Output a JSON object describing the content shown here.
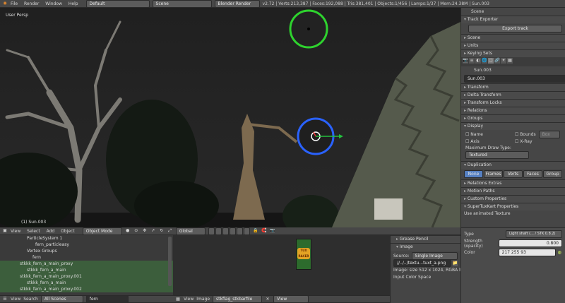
{
  "topbar": {
    "menus": [
      "File",
      "Render",
      "Window",
      "Help"
    ],
    "layout": "Default",
    "scene": "Scene",
    "engine": "Blender Render",
    "stats": "v2.72 | Verts:213,387 | Faces:192,088 | Tris:381,401 | Objects:1/456 | Lamps:1/37 | Mem:24.38M | Sun.003"
  },
  "viewport": {
    "label_view": "User Persp",
    "label_object": "(1) Sun.003",
    "header": {
      "menus": [
        "View",
        "Select",
        "Add",
        "Object"
      ],
      "mode": "Object Mode",
      "pivot": "Global"
    }
  },
  "outliner": {
    "rows": [
      "ParticleSystem 1",
      "fern_particleasy",
      "Vertex Groups",
      "fern",
      "stkkk_fern_a_main_proxy",
      "stkkk_fern_a_main",
      "stkkk_fern_a_main_proxy.001",
      "stkkk_fern_a_main",
      "stkkk_fern_a_main_proxy.002",
      "stkkk_fern_a_main"
    ],
    "footer": {
      "view": "View",
      "search": "Search",
      "filter": "All Scenes",
      "query": "fern"
    }
  },
  "image_editor": {
    "footer": {
      "view": "View",
      "image": "Image",
      "name": "stkflag_stkbarfile",
      "view2": "View"
    },
    "thumb_text": "TUX RACER"
  },
  "image_props": {
    "grease": "Grease Pencil",
    "image_title": "Image",
    "source_label": "Source:",
    "source_value": "Single Image",
    "path": "//../../textu...tuxt_a.png",
    "info": "Image: size 512 x 1024, RGBA byte",
    "colorspace": "Input Color Space"
  },
  "properties": {
    "scene_name": "Scene",
    "track_exporter": "Track Exporter",
    "export_button": "Export track",
    "panels_a": [
      "Scene",
      "Units",
      "Keying Sets"
    ],
    "object_name": "Sun.003",
    "object_field": "Sun.003",
    "panels_b": [
      "Transform",
      "Delta Transform",
      "Transform Locks",
      "Relations",
      "Groups"
    ],
    "display_title": "Display",
    "display_checks": {
      "name": "Name",
      "axis": "Axis",
      "bounds": "Bounds",
      "box": "Box",
      "xray": "X-Ray"
    },
    "max_draw_label": "Maximum Draw Type:",
    "max_draw_value": "Textured",
    "duplication_title": "Duplication",
    "dup_tabs": [
      "None",
      "Frames",
      "Verts",
      "Faces",
      "Group"
    ],
    "panels_c": [
      "Relations Extras",
      "Motion Paths",
      "Custom Properties",
      "SuperTuxKart Properties"
    ],
    "animated_texture": "Use animated Texture"
  },
  "stk_props": {
    "type_label": "Type",
    "type_value": "Light shaft (... / STK 0.8.2)",
    "strength_label": "Strength (opacity)",
    "strength_value": "0.800",
    "color_label": "Color",
    "color_value": "217 255 93"
  },
  "colors": {
    "lamp_ring": "#2ed32e",
    "selected_ring": "#2a62ff",
    "axis_x": "#e53030",
    "axis_y": "#23c23e",
    "outliner_green": "#3c5e3c"
  }
}
